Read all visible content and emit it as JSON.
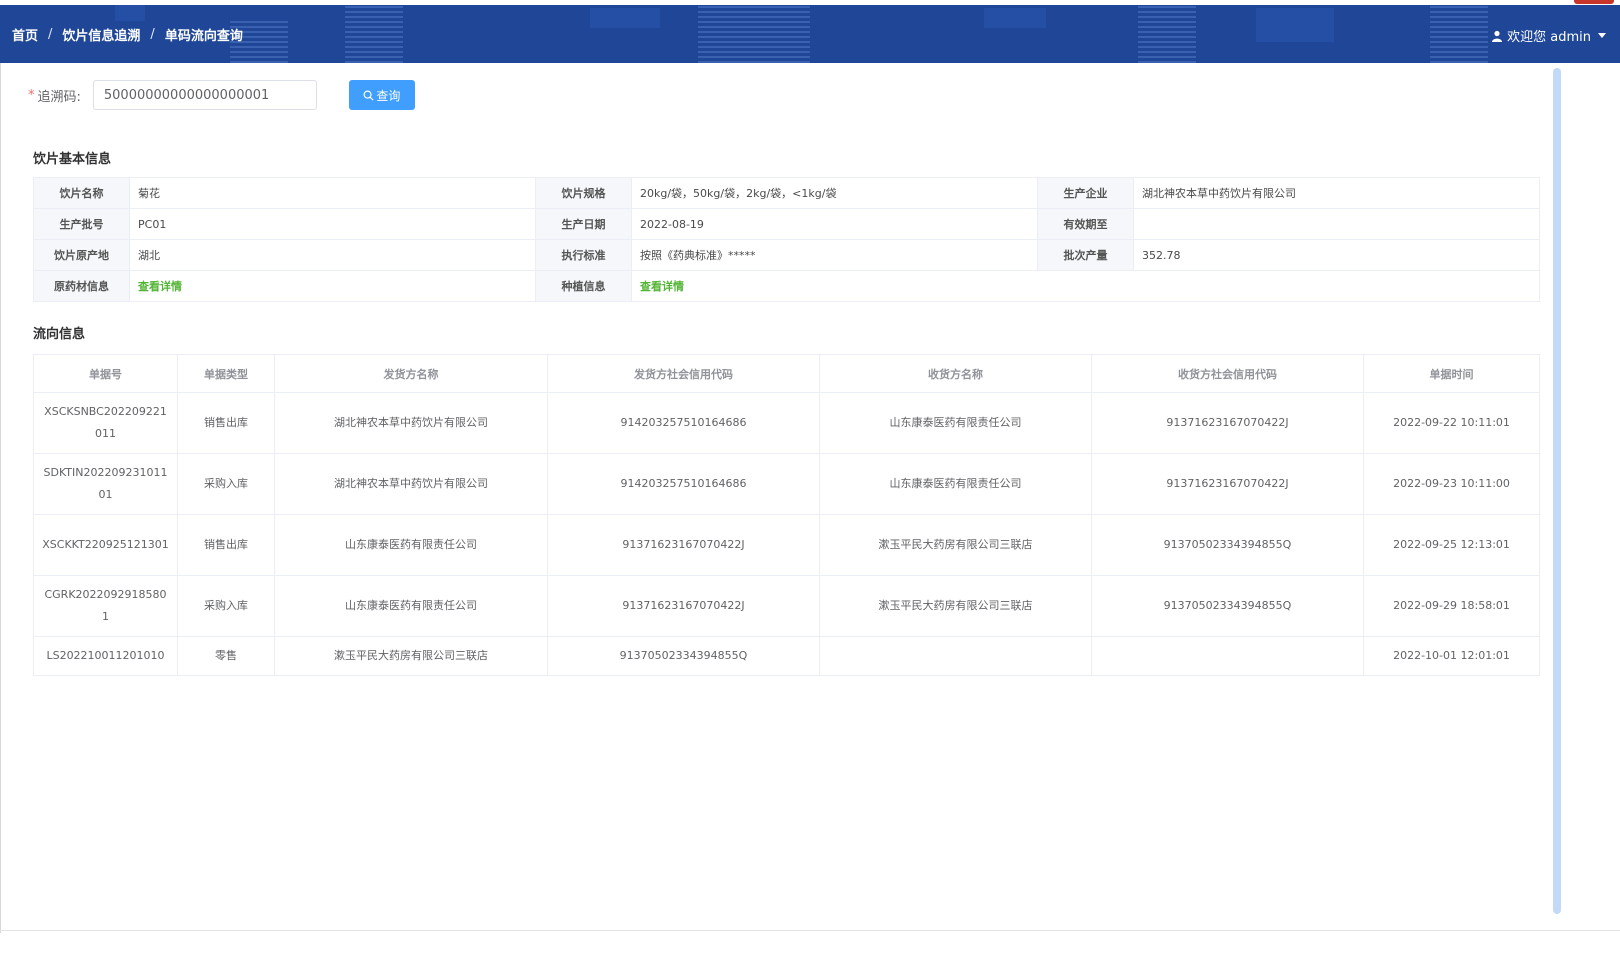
{
  "header": {
    "breadcrumb": [
      "首页",
      "饮片信息追溯",
      "单码流向查询"
    ],
    "separator": "/",
    "user_text": "欢迎您 admin",
    "colors": {
      "bg": "#1f4697",
      "text": "#ffffff"
    }
  },
  "search": {
    "required_mark": "*",
    "label": "追溯码:",
    "value": "50000000000000000001",
    "button_label": "查询",
    "button_color": "#409eff"
  },
  "basic_info": {
    "title": "饮片基本信息",
    "rows": [
      [
        {
          "label": "饮片名称",
          "value": "菊花"
        },
        {
          "label": "饮片规格",
          "value": "20kg/袋，50kg/袋，2kg/袋，<1kg/袋"
        },
        {
          "label": "生产企业",
          "value": "湖北神农本草中药饮片有限公司"
        }
      ],
      [
        {
          "label": "生产批号",
          "value": "PC01"
        },
        {
          "label": "生产日期",
          "value": "2022-08-19"
        },
        {
          "label": "有效期至",
          "value": ""
        }
      ],
      [
        {
          "label": "饮片原产地",
          "value": "湖北"
        },
        {
          "label": "执行标准",
          "value": "按照《药典标准》*****"
        },
        {
          "label": "批次产量",
          "value": "352.78"
        }
      ],
      [
        {
          "label": "原药材信息",
          "link": "查看详情"
        },
        {
          "label": "种植信息",
          "link": "查看详情"
        }
      ]
    ],
    "link_color": "#52b535"
  },
  "flow_info": {
    "title": "流向信息",
    "columns": [
      "单据号",
      "单据类型",
      "发货方名称",
      "发货方社会信用代码",
      "收货方名称",
      "收货方社会信用代码",
      "单据时间"
    ],
    "rows": [
      [
        "XSCKSNBC202209221011",
        "销售出库",
        "湖北神农本草中药饮片有限公司",
        "914203257510164686",
        "山东康泰医药有限责任公司",
        "91371623167070422J",
        "2022-09-22 10:11:01"
      ],
      [
        "SDKTIN20220923101101",
        "采购入库",
        "湖北神农本草中药饮片有限公司",
        "914203257510164686",
        "山东康泰医药有限责任公司",
        "91371623167070422J",
        "2022-09-23 10:11:00"
      ],
      [
        "XSCKKT220925121301",
        "销售出库",
        "山东康泰医药有限责任公司",
        "91371623167070422J",
        "漱玉平民大药房有限公司三联店",
        "91370502334394855Q",
        "2022-09-25 12:13:01"
      ],
      [
        "CGRK20220929185801",
        "采购入库",
        "山东康泰医药有限责任公司",
        "91371623167070422J",
        "漱玉平民大药房有限公司三联店",
        "91370502334394855Q",
        "2022-09-29 18:58:01"
      ],
      [
        "LS202210011201010",
        "零售",
        "漱玉平民大药房有限公司三联店",
        "91370502334394855Q",
        "",
        "",
        "2022-10-01 12:01:01"
      ]
    ]
  }
}
